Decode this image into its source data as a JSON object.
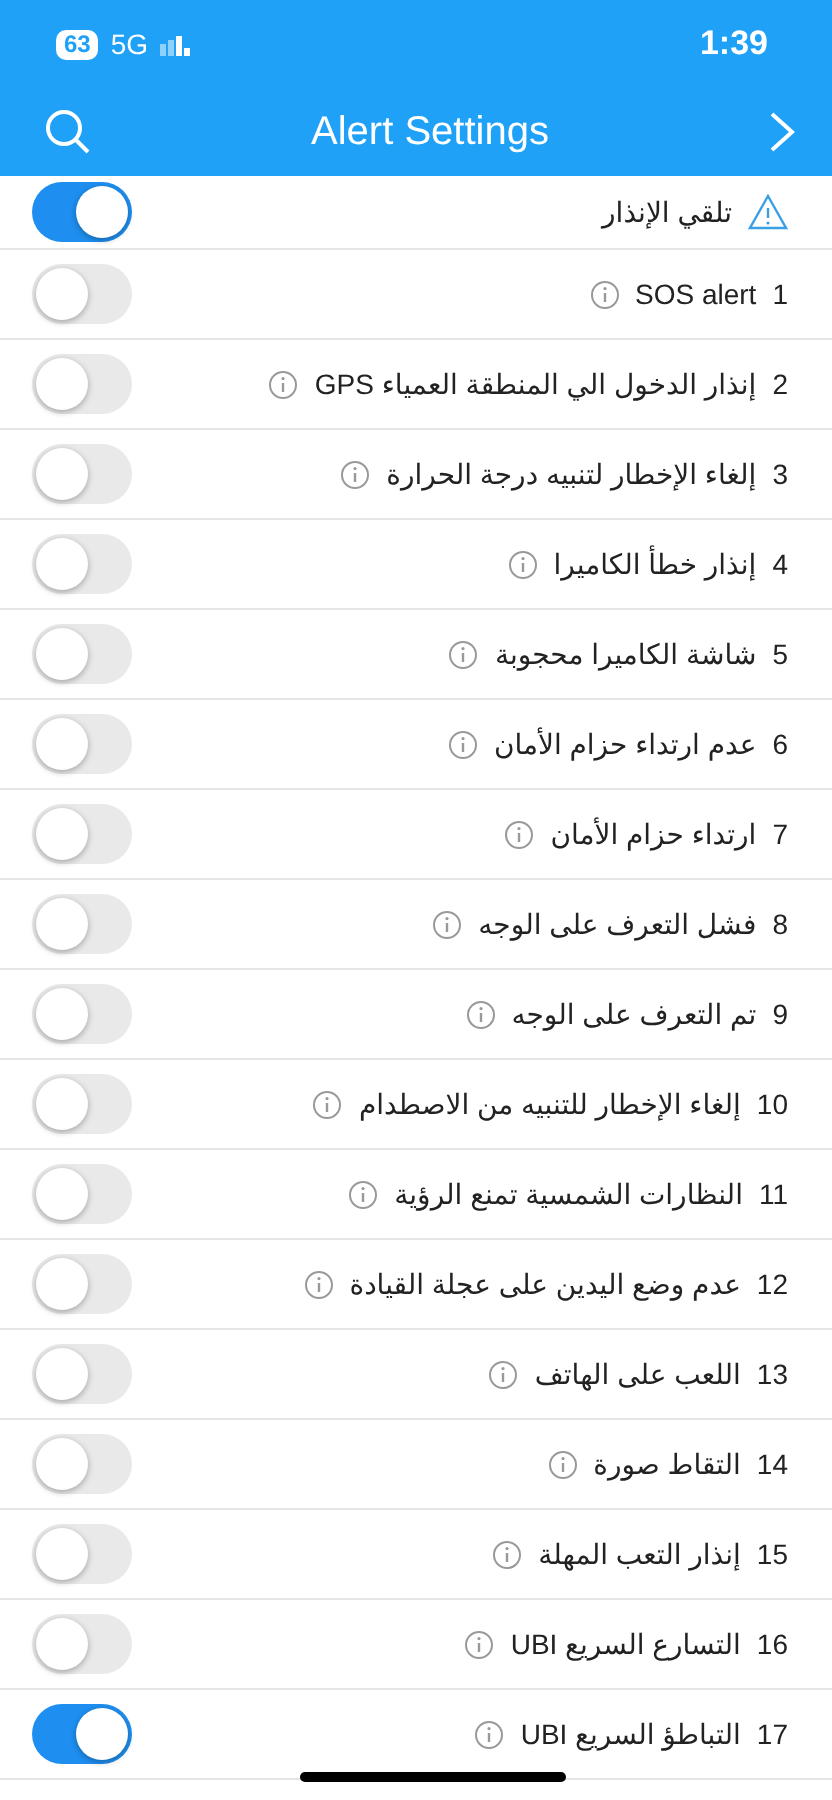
{
  "status_bar": {
    "battery": "63",
    "network": "5G",
    "time": "1:39"
  },
  "nav": {
    "title": "Alert Settings"
  },
  "master": {
    "label": "تلقي الإنذار",
    "on": true
  },
  "alerts": [
    {
      "number": "1",
      "label": "SOS  alert",
      "on": false
    },
    {
      "number": "2",
      "label": "إنذار الدخول الي المنطقة العمياء GPS",
      "on": false
    },
    {
      "number": "3",
      "label": "إلغاء الإخطار لتنبيه درجة الحرارة",
      "on": false
    },
    {
      "number": "4",
      "label": "إنذار خطأ الكاميرا",
      "on": false
    },
    {
      "number": "5",
      "label": "شاشة الكاميرا محجوبة",
      "on": false
    },
    {
      "number": "6",
      "label": "عدم ارتداء حزام الأمان",
      "on": false
    },
    {
      "number": "7",
      "label": "ارتداء حزام الأمان",
      "on": false
    },
    {
      "number": "8",
      "label": "فشل التعرف على الوجه",
      "on": false
    },
    {
      "number": "9",
      "label": "تم التعرف على الوجه",
      "on": false
    },
    {
      "number": "10",
      "label": "إلغاء الإخطار للتنبيه من الاصطدام",
      "on": false
    },
    {
      "number": "11",
      "label": "النظارات الشمسية تمنع الرؤية",
      "on": false
    },
    {
      "number": "12",
      "label": "عدم وضع اليدين على عجلة القيادة",
      "on": false
    },
    {
      "number": "13",
      "label": "اللعب على الهاتف",
      "on": false
    },
    {
      "number": "14",
      "label": "التقاط صورة",
      "on": false
    },
    {
      "number": "15",
      "label": "إنذار التعب المهلة",
      "on": false
    },
    {
      "number": "16",
      "label": "التسارع السريع UBI",
      "on": false
    },
    {
      "number": "17",
      "label": "التباطؤ السريع UBI",
      "on": true
    }
  ]
}
